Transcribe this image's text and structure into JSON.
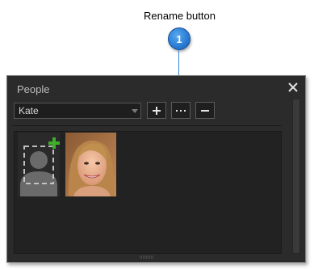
{
  "callout": {
    "title": "Rename button",
    "badge_number": "1"
  },
  "panel": {
    "title": "People",
    "close_icon": "close-icon",
    "person_select": {
      "selected_value": "Kate"
    },
    "toolbar": {
      "add_label": "+",
      "rename_label": "...",
      "remove_label": "−"
    },
    "faces": [
      {
        "type": "add-person",
        "icon": "add-person-icon"
      },
      {
        "type": "photo",
        "icon": "face-photo"
      }
    ]
  },
  "colors": {
    "panel_bg": "#2b2b2b",
    "callout_blue": "#2a7fd6",
    "plus_green": "#3fae2a"
  }
}
